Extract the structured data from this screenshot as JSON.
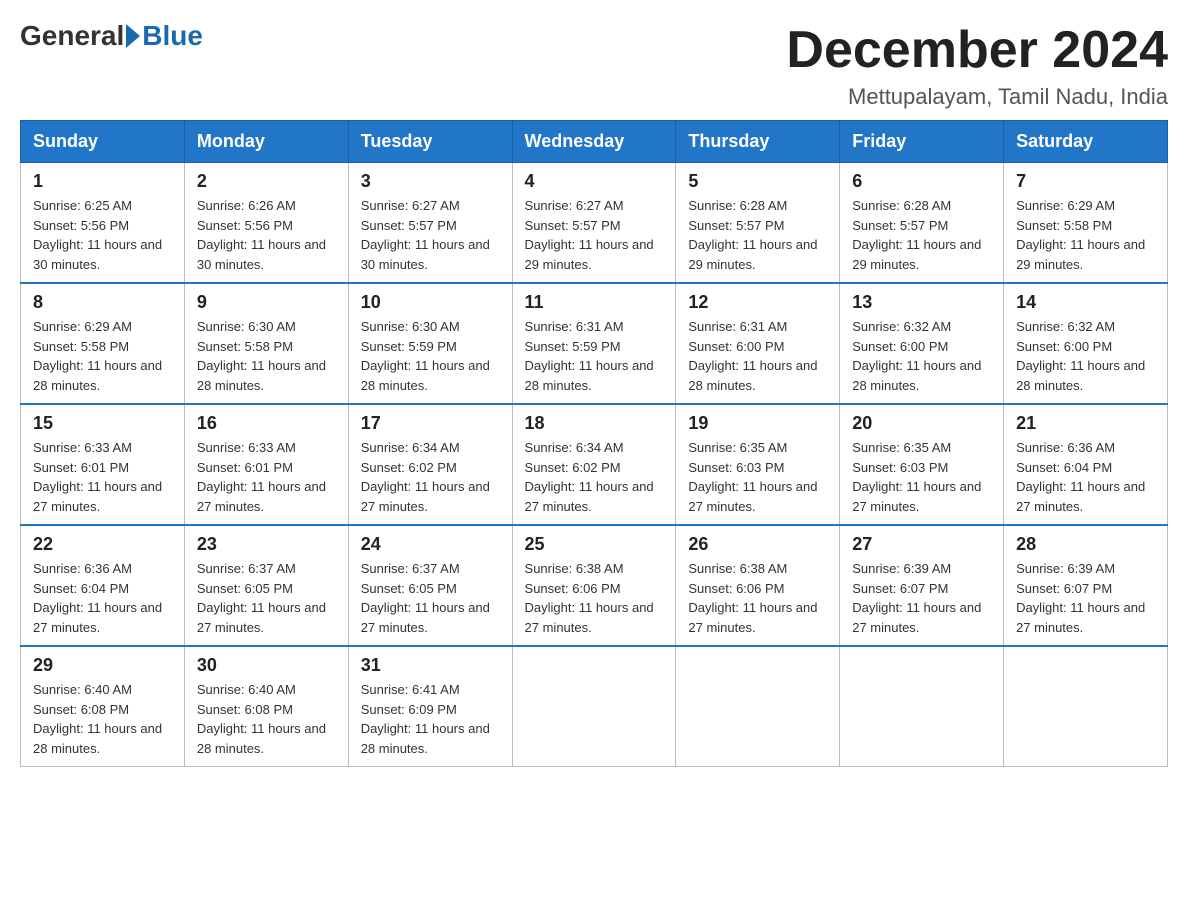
{
  "header": {
    "logo_general": "General",
    "logo_blue": "Blue",
    "month_title": "December 2024",
    "location": "Mettupalayam, Tamil Nadu, India"
  },
  "weekdays": [
    "Sunday",
    "Monday",
    "Tuesday",
    "Wednesday",
    "Thursday",
    "Friday",
    "Saturday"
  ],
  "weeks": [
    [
      {
        "day": "1",
        "sunrise": "6:25 AM",
        "sunset": "5:56 PM",
        "daylight": "11 hours and 30 minutes."
      },
      {
        "day": "2",
        "sunrise": "6:26 AM",
        "sunset": "5:56 PM",
        "daylight": "11 hours and 30 minutes."
      },
      {
        "day": "3",
        "sunrise": "6:27 AM",
        "sunset": "5:57 PM",
        "daylight": "11 hours and 30 minutes."
      },
      {
        "day": "4",
        "sunrise": "6:27 AM",
        "sunset": "5:57 PM",
        "daylight": "11 hours and 29 minutes."
      },
      {
        "day": "5",
        "sunrise": "6:28 AM",
        "sunset": "5:57 PM",
        "daylight": "11 hours and 29 minutes."
      },
      {
        "day": "6",
        "sunrise": "6:28 AM",
        "sunset": "5:57 PM",
        "daylight": "11 hours and 29 minutes."
      },
      {
        "day": "7",
        "sunrise": "6:29 AM",
        "sunset": "5:58 PM",
        "daylight": "11 hours and 29 minutes."
      }
    ],
    [
      {
        "day": "8",
        "sunrise": "6:29 AM",
        "sunset": "5:58 PM",
        "daylight": "11 hours and 28 minutes."
      },
      {
        "day": "9",
        "sunrise": "6:30 AM",
        "sunset": "5:58 PM",
        "daylight": "11 hours and 28 minutes."
      },
      {
        "day": "10",
        "sunrise": "6:30 AM",
        "sunset": "5:59 PM",
        "daylight": "11 hours and 28 minutes."
      },
      {
        "day": "11",
        "sunrise": "6:31 AM",
        "sunset": "5:59 PM",
        "daylight": "11 hours and 28 minutes."
      },
      {
        "day": "12",
        "sunrise": "6:31 AM",
        "sunset": "6:00 PM",
        "daylight": "11 hours and 28 minutes."
      },
      {
        "day": "13",
        "sunrise": "6:32 AM",
        "sunset": "6:00 PM",
        "daylight": "11 hours and 28 minutes."
      },
      {
        "day": "14",
        "sunrise": "6:32 AM",
        "sunset": "6:00 PM",
        "daylight": "11 hours and 28 minutes."
      }
    ],
    [
      {
        "day": "15",
        "sunrise": "6:33 AM",
        "sunset": "6:01 PM",
        "daylight": "11 hours and 27 minutes."
      },
      {
        "day": "16",
        "sunrise": "6:33 AM",
        "sunset": "6:01 PM",
        "daylight": "11 hours and 27 minutes."
      },
      {
        "day": "17",
        "sunrise": "6:34 AM",
        "sunset": "6:02 PM",
        "daylight": "11 hours and 27 minutes."
      },
      {
        "day": "18",
        "sunrise": "6:34 AM",
        "sunset": "6:02 PM",
        "daylight": "11 hours and 27 minutes."
      },
      {
        "day": "19",
        "sunrise": "6:35 AM",
        "sunset": "6:03 PM",
        "daylight": "11 hours and 27 minutes."
      },
      {
        "day": "20",
        "sunrise": "6:35 AM",
        "sunset": "6:03 PM",
        "daylight": "11 hours and 27 minutes."
      },
      {
        "day": "21",
        "sunrise": "6:36 AM",
        "sunset": "6:04 PM",
        "daylight": "11 hours and 27 minutes."
      }
    ],
    [
      {
        "day": "22",
        "sunrise": "6:36 AM",
        "sunset": "6:04 PM",
        "daylight": "11 hours and 27 minutes."
      },
      {
        "day": "23",
        "sunrise": "6:37 AM",
        "sunset": "6:05 PM",
        "daylight": "11 hours and 27 minutes."
      },
      {
        "day": "24",
        "sunrise": "6:37 AM",
        "sunset": "6:05 PM",
        "daylight": "11 hours and 27 minutes."
      },
      {
        "day": "25",
        "sunrise": "6:38 AM",
        "sunset": "6:06 PM",
        "daylight": "11 hours and 27 minutes."
      },
      {
        "day": "26",
        "sunrise": "6:38 AM",
        "sunset": "6:06 PM",
        "daylight": "11 hours and 27 minutes."
      },
      {
        "day": "27",
        "sunrise": "6:39 AM",
        "sunset": "6:07 PM",
        "daylight": "11 hours and 27 minutes."
      },
      {
        "day": "28",
        "sunrise": "6:39 AM",
        "sunset": "6:07 PM",
        "daylight": "11 hours and 27 minutes."
      }
    ],
    [
      {
        "day": "29",
        "sunrise": "6:40 AM",
        "sunset": "6:08 PM",
        "daylight": "11 hours and 28 minutes."
      },
      {
        "day": "30",
        "sunrise": "6:40 AM",
        "sunset": "6:08 PM",
        "daylight": "11 hours and 28 minutes."
      },
      {
        "day": "31",
        "sunrise": "6:41 AM",
        "sunset": "6:09 PM",
        "daylight": "11 hours and 28 minutes."
      },
      null,
      null,
      null,
      null
    ]
  ],
  "labels": {
    "sunrise_prefix": "Sunrise: ",
    "sunset_prefix": "Sunset: ",
    "daylight_prefix": "Daylight: "
  }
}
